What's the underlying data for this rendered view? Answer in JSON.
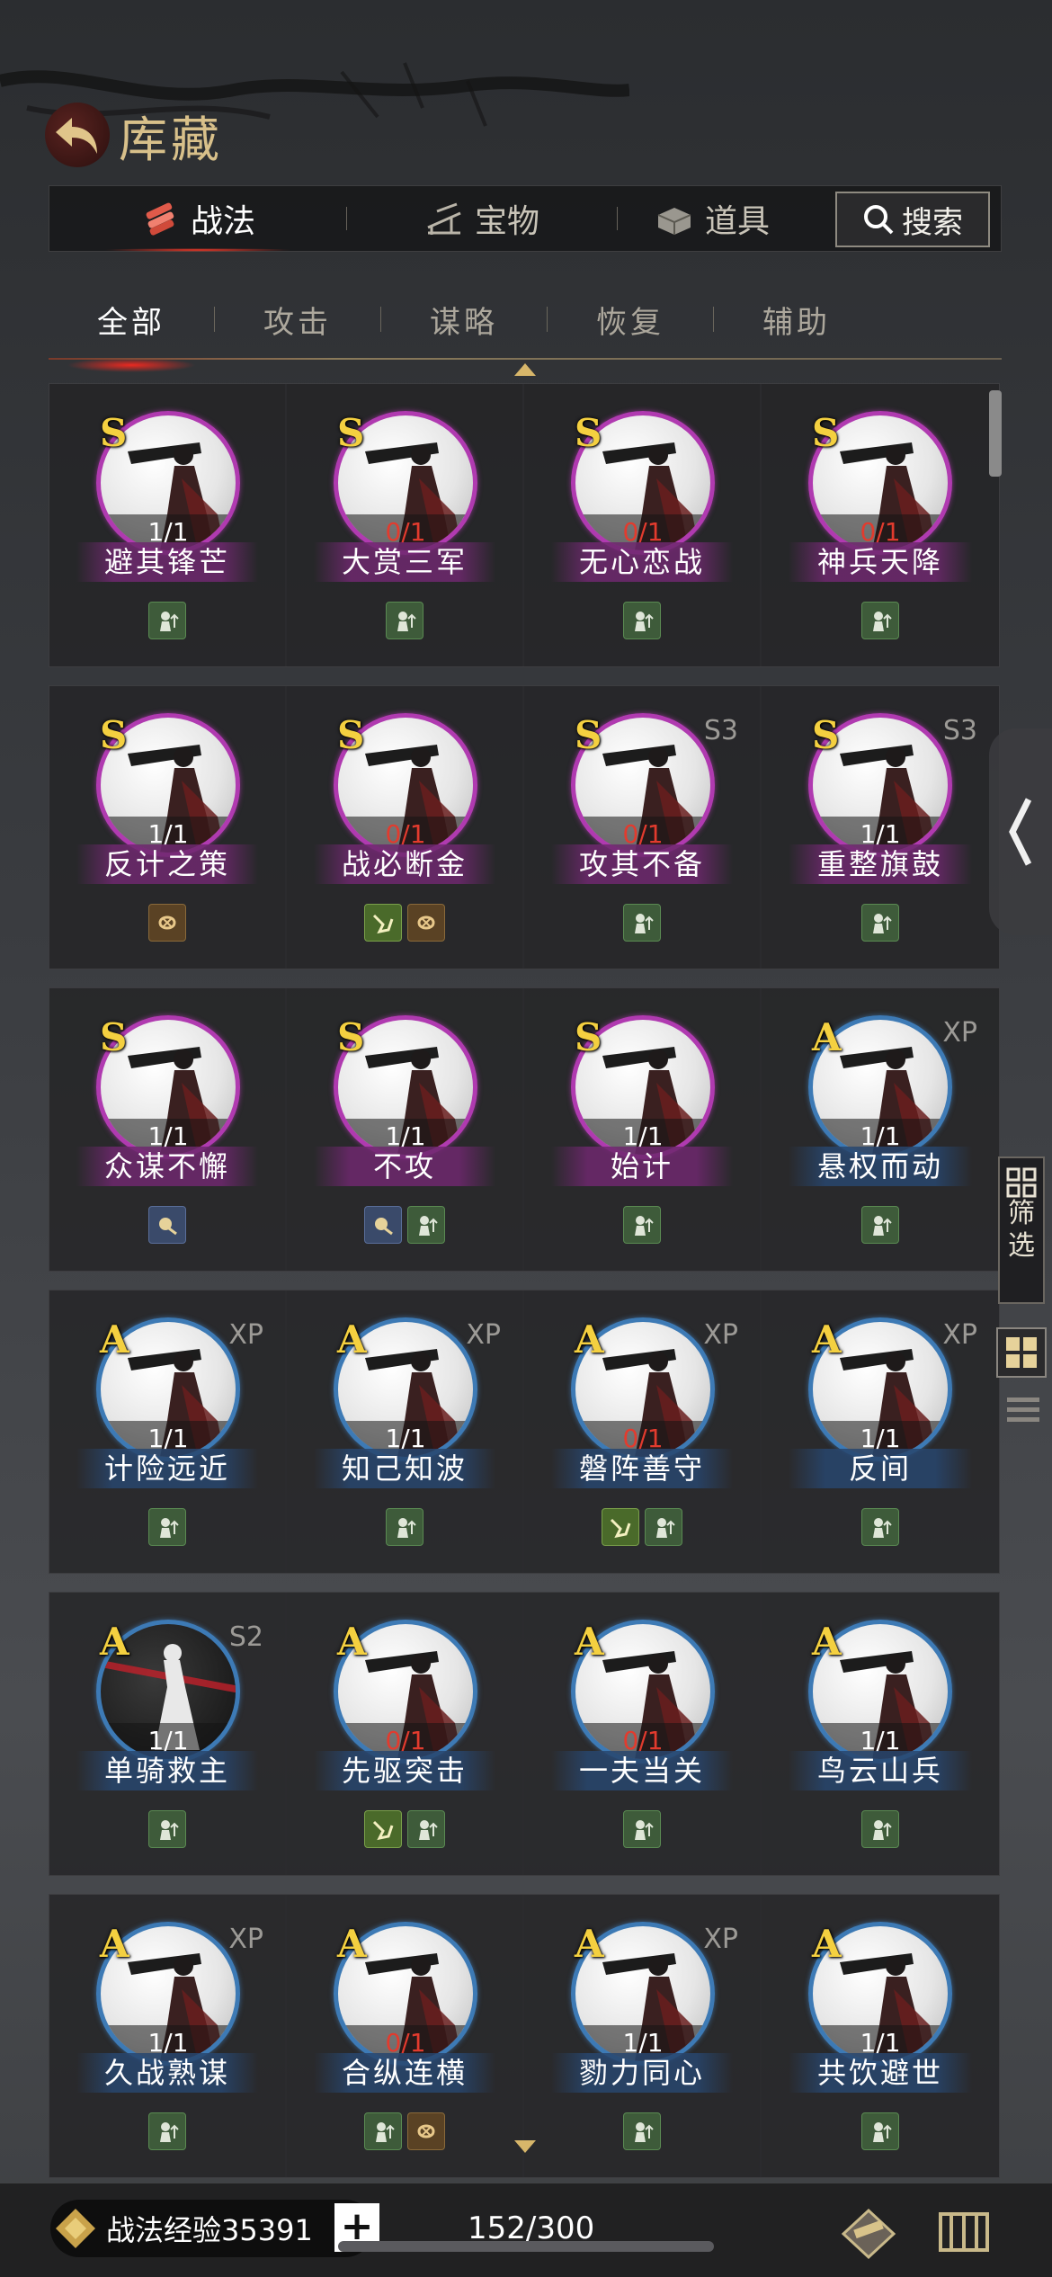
{
  "header": {
    "title": "库藏"
  },
  "top_tabs": [
    {
      "label": "战法",
      "active": true,
      "icon": "scroll-bundle-icon"
    },
    {
      "label": "宝物",
      "active": false,
      "icon": "pavilion-icon"
    },
    {
      "label": "道具",
      "active": false,
      "icon": "chest-icon"
    }
  ],
  "search": {
    "label": "搜索"
  },
  "sub_tabs": [
    {
      "label": "全部",
      "active": true
    },
    {
      "label": "攻击",
      "active": false
    },
    {
      "label": "谋略",
      "active": false
    },
    {
      "label": "恢复",
      "active": false
    },
    {
      "label": "辅助",
      "active": false
    }
  ],
  "rows": [
    [
      {
        "grade": "S",
        "tag": "",
        "count": "1/1",
        "zero": false,
        "name": "避其锋芒",
        "badges": [
          "green"
        ]
      },
      {
        "grade": "S",
        "tag": "",
        "count": "0/1",
        "zero": true,
        "name": "大赏三军",
        "badges": [
          "green"
        ]
      },
      {
        "grade": "S",
        "tag": "",
        "count": "0/1",
        "zero": true,
        "name": "无心恋战",
        "badges": [
          "green"
        ]
      },
      {
        "grade": "S",
        "tag": "",
        "count": "0/1",
        "zero": true,
        "name": "神兵天降",
        "badges": [
          "green"
        ]
      }
    ],
    [
      {
        "grade": "S",
        "tag": "",
        "count": "1/1",
        "zero": false,
        "name": "反计之策",
        "badges": [
          "brown"
        ]
      },
      {
        "grade": "S",
        "tag": "",
        "count": "0/1",
        "zero": true,
        "name": "战必断金",
        "badges": [
          "yellowgreen",
          "brown"
        ]
      },
      {
        "grade": "S",
        "tag": "S3",
        "count": "0/1",
        "zero": true,
        "name": "攻其不备",
        "badges": [
          "green"
        ]
      },
      {
        "grade": "S",
        "tag": "S3",
        "count": "1/1",
        "zero": false,
        "name": "重整旗鼓",
        "badges": [
          "green"
        ]
      }
    ],
    [
      {
        "grade": "S",
        "tag": "",
        "count": "1/1",
        "zero": false,
        "name": "众谋不懈",
        "badges": [
          "blue"
        ]
      },
      {
        "grade": "S",
        "tag": "",
        "count": "1/1",
        "zero": false,
        "name": "不攻",
        "badges": [
          "blue",
          "green"
        ]
      },
      {
        "grade": "S",
        "tag": "",
        "count": "1/1",
        "zero": false,
        "name": "始计",
        "badges": [
          "green"
        ]
      },
      {
        "grade": "A",
        "tag": "XP",
        "count": "1/1",
        "zero": false,
        "name": "悬权而动",
        "badges": [
          "green"
        ]
      }
    ],
    [
      {
        "grade": "A",
        "tag": "XP",
        "count": "1/1",
        "zero": false,
        "name": "计险远近",
        "badges": [
          "green"
        ]
      },
      {
        "grade": "A",
        "tag": "XP",
        "count": "1/1",
        "zero": false,
        "name": "知己知波",
        "badges": [
          "green"
        ]
      },
      {
        "grade": "A",
        "tag": "XP",
        "count": "0/1",
        "zero": true,
        "name": "磐阵善守",
        "badges": [
          "yellowgreen",
          "green"
        ]
      },
      {
        "grade": "A",
        "tag": "XP",
        "count": "1/1",
        "zero": false,
        "name": "反间",
        "badges": [
          "green"
        ]
      }
    ],
    [
      {
        "grade": "A",
        "tag": "S2",
        "count": "1/1",
        "zero": false,
        "name": "单骑救主",
        "badges": [
          "green"
        ],
        "dark": true
      },
      {
        "grade": "A",
        "tag": "",
        "count": "0/1",
        "zero": true,
        "name": "先驱突击",
        "badges": [
          "yellowgreen",
          "green"
        ]
      },
      {
        "grade": "A",
        "tag": "",
        "count": "0/1",
        "zero": true,
        "name": "一夫当关",
        "badges": [
          "green"
        ]
      },
      {
        "grade": "A",
        "tag": "",
        "count": "1/1",
        "zero": false,
        "name": "鸟云山兵",
        "badges": [
          "green"
        ]
      }
    ],
    [
      {
        "grade": "A",
        "tag": "XP",
        "count": "1/1",
        "zero": false,
        "name": "久战熟谋",
        "badges": [
          "green"
        ]
      },
      {
        "grade": "A",
        "tag": "",
        "count": "0/1",
        "zero": true,
        "name": "合纵连横",
        "badges": [
          "green",
          "brown"
        ]
      },
      {
        "grade": "A",
        "tag": "XP",
        "count": "1/1",
        "zero": false,
        "name": "勠力同心",
        "badges": [
          "green"
        ]
      },
      {
        "grade": "A",
        "tag": "",
        "count": "1/1",
        "zero": false,
        "name": "共饮避世",
        "badges": [
          "green"
        ]
      }
    ]
  ],
  "side": {
    "filter_label_1": "筛",
    "filter_label_2": "选"
  },
  "bottom": {
    "exp_label": "战法经验35391",
    "plus": "+",
    "capacity": "152/300"
  }
}
